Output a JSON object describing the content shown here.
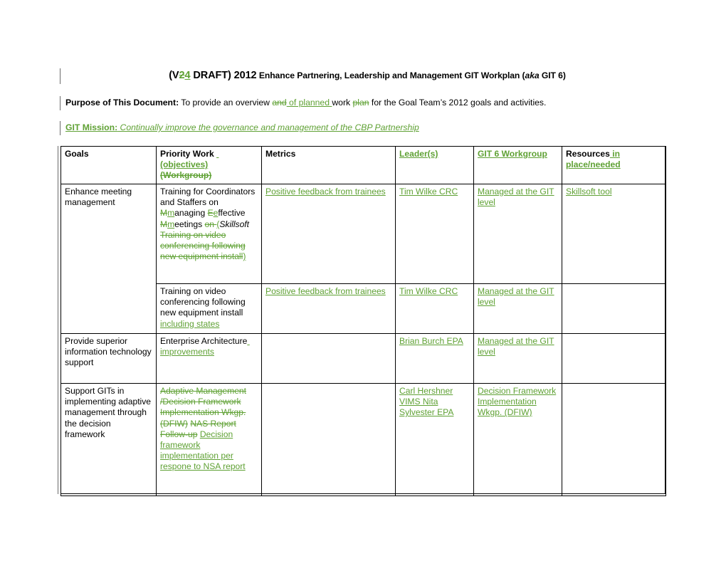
{
  "document": {
    "title": {
      "prefix": "(V",
      "version_old": "2",
      "version_new": "4",
      "draft": " DRAFT) 2012",
      "rest": "Enhance Partnering, Leadership and Management GIT Workplan (",
      "aka": "aka",
      "tail": " GIT 6)"
    },
    "purpose": {
      "label": "Purpose of This Document:",
      "t1": "  To provide an overview ",
      "del1": "and",
      "ins1": " of planned ",
      "t2": " work ",
      "del2": "plan",
      "t3": " for the Goal Team’s 2012 goals and activities."
    },
    "mission": {
      "label": "GIT Mission:",
      "text": "  Continually improve the governance and management of the CBP Partnership"
    }
  },
  "table": {
    "headers": {
      "goals": "Goals",
      "priority_base": "Priority Work ",
      "priority_ins": "(objectives)",
      "priority_del": "(Workgroup)",
      "metrics": "Metrics",
      "leader": "Leader(s)",
      "workgroup": "GIT 6 Workgroup",
      "resources_base": "Resources",
      "resources_ins": " in place/needed"
    },
    "rows": [
      {
        "goal": "Enhance meeting management",
        "priority": {
          "t1": "Training for Coordinators and Staffers on ",
          "del_m": "M",
          "ins_m": "m",
          "t2": "anaging ",
          "del_e": "E",
          "ins_e": "e",
          "t3": "ffective ",
          "del_m2": "M",
          "ins_m2": "m",
          "t4": "eetings ",
          "del_on": "on ",
          "ins_paren": "(",
          "skillsoft": "Skillsoft",
          "del_block": "Training on video conferencing following new equipment install",
          "ins_close": ")"
        },
        "metrics": "Positive feedback from trainees",
        "leader": "Tim Wilke CRC",
        "workgroup": "Managed at the GIT level",
        "resources": "Skillsoft tool"
      },
      {
        "priority_base": "Training on video conferencing following new equipment install",
        "priority_ins": " including states",
        "metrics": "Positive feedback from trainees",
        "leader": "Tim Wilke CRC",
        "workgroup": "Managed at the GIT level",
        "resources": ""
      },
      {
        "goal": "Provide superior information technology support",
        "priority_base": "Enterprise Architecture",
        "priority_ins": " improvements",
        "metrics": "",
        "leader": "Brian Burch EPA",
        "workgroup": "Managed at the GIT level",
        "resources": ""
      },
      {
        "goal": "Support GITs in implementing adaptive management through the decision framework",
        "priority_del1": "Adaptive Management /Decision Framework Implementation Wkgp. (DFIW)",
        "priority_del2": "NAS Report Follow-up",
        "priority_ins": "Decision framework implementation per respone to NSA report",
        "metrics": "",
        "leader_ins": "Carl Hershner VIMS Nita Sylvester EPA",
        "workgroup_ins": "Decision Framework Implementation Wkgp. (DFIW)",
        "resources": ""
      }
    ]
  },
  "colors": {
    "tracked_change_green": "#5FA134",
    "text_black": "#000000",
    "change_bar": "#6B6B6B"
  }
}
